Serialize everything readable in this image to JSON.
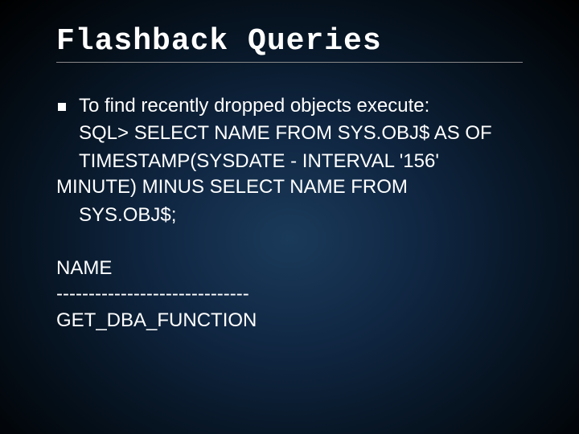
{
  "title": "Flashback Queries",
  "bullet_text": "To find recently dropped  objects execute:",
  "sql_line1": "SQL> SELECT NAME FROM SYS.OBJ$ AS OF",
  "sql_line2": "TIMESTAMP(SYSDATE - INTERVAL '156'",
  "sql_line3": "MINUTE) MINUS SELECT NAME FROM",
  "sql_line4": "SYS.OBJ$;",
  "result_header": "NAME",
  "result_divider": "------------------------------",
  "result_value": "GET_DBA_FUNCTION"
}
